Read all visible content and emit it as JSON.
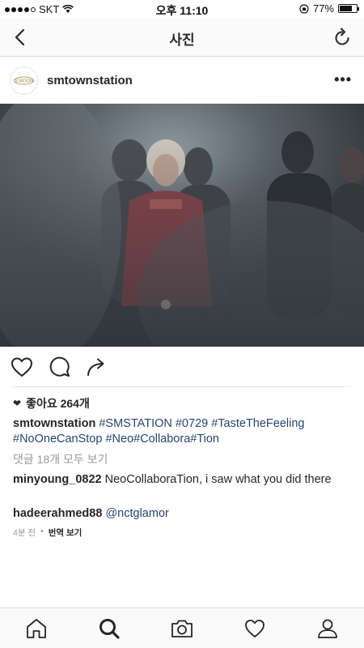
{
  "status_bar": {
    "carrier": "SKT",
    "time": "오후 11:10",
    "battery": "77%",
    "battery_level": 0.77
  },
  "nav": {
    "title": "사진",
    "back_icon": "chevron-left-icon",
    "refresh_icon": "refresh-icon"
  },
  "post": {
    "username": "smtownstation",
    "avatar_text": "STATION",
    "more_label": "•••"
  },
  "likes": {
    "label": "좋아요 264개"
  },
  "caption": {
    "user": "smtownstation",
    "tags_line1": "#SMSTATION #0729 #TasteTheFeeling",
    "tags_line2": "#NoOneCanStop #Neo#Collabora#Tion"
  },
  "view_all_comments": "댓글 18개 모두 보기",
  "comments": [
    {
      "user": "minyoung_0822",
      "text": "NeoCollaboraTion, i saw what you did there"
    },
    {
      "user": "hadeerahmed88",
      "text": "@nctglamor"
    }
  ],
  "meta": {
    "time_ago": "4분 전",
    "separator": "•",
    "translate": "번역 보기"
  },
  "tabbar": {
    "items": [
      "home-icon",
      "search-icon",
      "camera-icon",
      "activity-heart-icon",
      "profile-icon"
    ],
    "active": "search-icon"
  }
}
